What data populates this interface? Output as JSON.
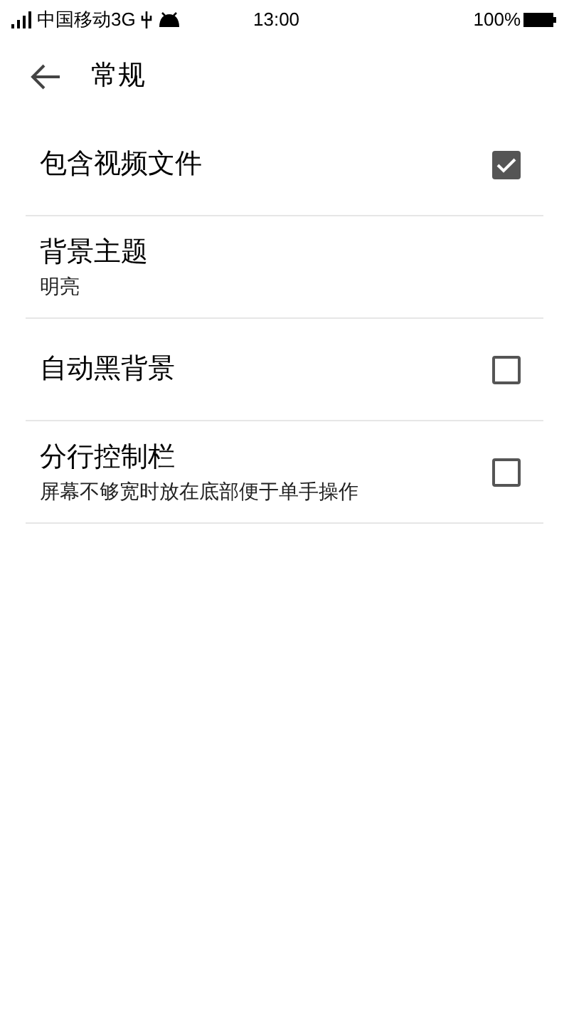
{
  "status_bar": {
    "carrier": "中国移动3G",
    "time": "13:00",
    "battery": "100%"
  },
  "header": {
    "title": "常规"
  },
  "settings": [
    {
      "kind": "checkbox",
      "title": "包含视频文件",
      "checked": true
    },
    {
      "kind": "plain",
      "title": "背景主题",
      "subtitle": "明亮"
    },
    {
      "kind": "checkbox",
      "title": "自动黑背景",
      "checked": false
    },
    {
      "kind": "checkbox",
      "title": "分行控制栏",
      "subtitle": "屏幕不够宽时放在底部便于单手操作",
      "checked": false
    }
  ]
}
